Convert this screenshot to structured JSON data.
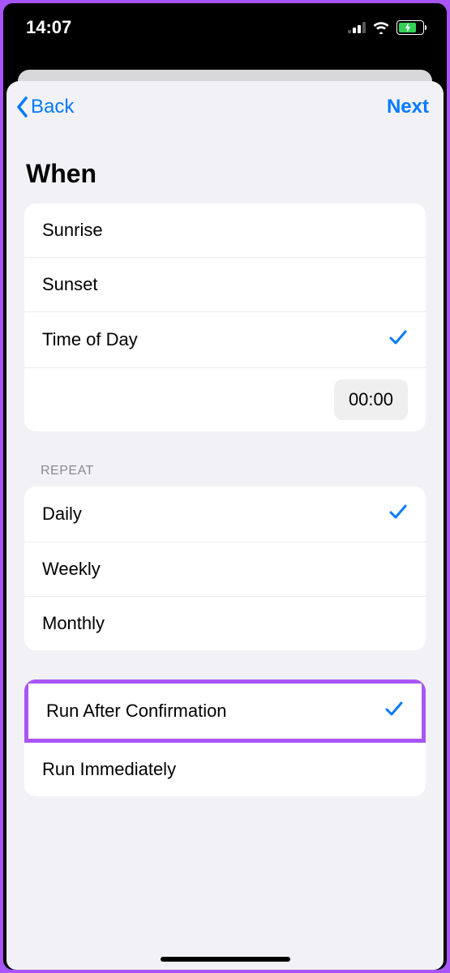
{
  "status_bar": {
    "time": "14:07"
  },
  "nav": {
    "back_label": "Back",
    "next_label": "Next"
  },
  "page": {
    "title": "When"
  },
  "when_options": {
    "sunrise": "Sunrise",
    "sunset": "Sunset",
    "time_of_day": "Time of Day",
    "time_value": "00:00"
  },
  "repeat_section": {
    "header": "REPEAT",
    "daily": "Daily",
    "weekly": "Weekly",
    "monthly": "Monthly"
  },
  "run_section": {
    "after_confirmation": "Run After Confirmation",
    "immediately": "Run Immediately"
  }
}
